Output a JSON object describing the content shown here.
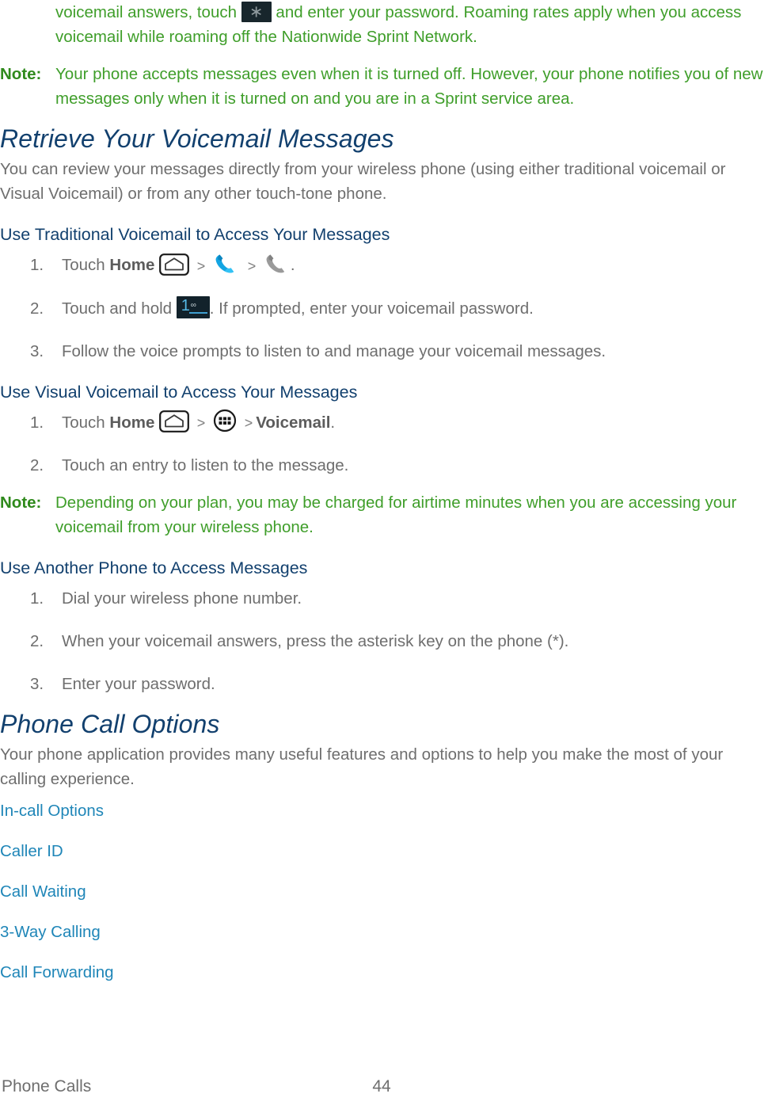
{
  "document": {
    "title": "Phone Calls",
    "page_number": "44"
  },
  "intro": {
    "note_continuation_line1": "voicemail answers, touch",
    "note_continuation_line1_after": "and enter your password. Roaming rates apply when you",
    "note_continuation_line2": "access voicemail while roaming off the Nationwide Sprint Network."
  },
  "note_top": {
    "label": "Note:",
    "text": "Your phone accepts messages even when it is turned off. However, your phone notifies you of new messages only when it is turned on and you are in a Sprint service area."
  },
  "section_retrieve": {
    "heading": "Retrieve Your Voicemail Messages",
    "body": "You can review your messages directly from your wireless phone (using either traditional voicemail or Visual Voicemail) or from any other touch-tone phone."
  },
  "sub_traditional": {
    "heading": "Use Traditional Voicemail to Access Your Messages",
    "steps": [
      {
        "number": "1.",
        "prefix": "Touch ",
        "bold": "Home",
        "suffix": "."
      },
      {
        "number": "2.",
        "prefix": "Touch and hold ",
        "suffix": ". If prompted, enter your voicemail password."
      },
      {
        "number": "3.",
        "text": "Follow the voice prompts to listen to and manage your voicemail messages."
      }
    ]
  },
  "sub_visual": {
    "heading": "Use Visual Voicemail to Access Your Messages",
    "steps": [
      {
        "number": "1.",
        "prefix": "Touch ",
        "bold": "Home",
        "bold2": "Voicemail",
        "suffix": "."
      },
      {
        "number": "2.",
        "text": "Touch an entry to listen to the message."
      }
    ]
  },
  "note_visual": {
    "label": "Note:",
    "text": "Depending on your plan, you may be charged for airtime minutes when you are accessing your voicemail from your wireless phone."
  },
  "sub_another": {
    "heading": "Use Another Phone to Access Messages",
    "steps": [
      {
        "number": "1.",
        "text": "Dial your wireless phone number."
      },
      {
        "number": "2.",
        "text": "When your voicemail answers, press the asterisk key on the phone (*)."
      },
      {
        "number": "3.",
        "text": "Enter your password."
      }
    ]
  },
  "section_options": {
    "heading": "Phone Call Options",
    "body": "Your phone application provides many useful features and options to help you make the most of your calling experience.",
    "links": [
      "In-call Options",
      "Caller ID",
      "Call Waiting",
      "3-Way Calling",
      "Call Forwarding"
    ]
  },
  "icons": {
    "asterisk_key": "asterisk-key-icon",
    "voicemail_one_key": "voicemail-one-key-icon",
    "home_key": "home-key-icon",
    "phone_blue": "phone-handset-blue-icon",
    "phone_gray": "phone-handset-gray-icon",
    "apps_grid": "apps-grid-icon",
    "chevron": ">"
  },
  "colors": {
    "note_green": "#3f9e2a",
    "heading_navy": "#12406e",
    "link_blue": "#1f86b8",
    "body_gray": "#6e6e6e",
    "key_dark": "#12222b",
    "phone_blue": "#00a2e2"
  }
}
